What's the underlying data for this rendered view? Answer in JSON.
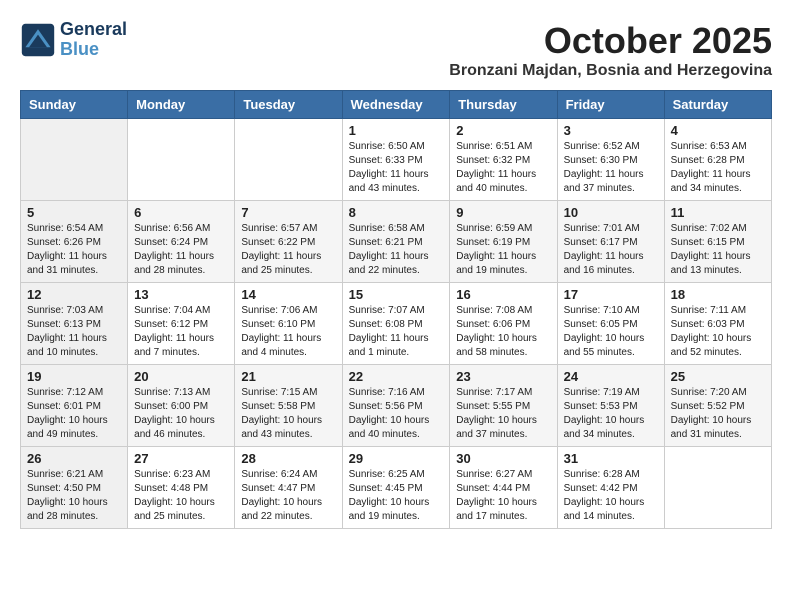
{
  "logo": {
    "line1": "General",
    "line2": "Blue"
  },
  "title": "October 2025",
  "location": "Bronzani Majdan, Bosnia and Herzegovina",
  "weekdays": [
    "Sunday",
    "Monday",
    "Tuesday",
    "Wednesday",
    "Thursday",
    "Friday",
    "Saturday"
  ],
  "weeks": [
    [
      {
        "day": "",
        "info": ""
      },
      {
        "day": "",
        "info": ""
      },
      {
        "day": "",
        "info": ""
      },
      {
        "day": "1",
        "info": "Sunrise: 6:50 AM\nSunset: 6:33 PM\nDaylight: 11 hours and 43 minutes."
      },
      {
        "day": "2",
        "info": "Sunrise: 6:51 AM\nSunset: 6:32 PM\nDaylight: 11 hours and 40 minutes."
      },
      {
        "day": "3",
        "info": "Sunrise: 6:52 AM\nSunset: 6:30 PM\nDaylight: 11 hours and 37 minutes."
      },
      {
        "day": "4",
        "info": "Sunrise: 6:53 AM\nSunset: 6:28 PM\nDaylight: 11 hours and 34 minutes."
      }
    ],
    [
      {
        "day": "5",
        "info": "Sunrise: 6:54 AM\nSunset: 6:26 PM\nDaylight: 11 hours and 31 minutes."
      },
      {
        "day": "6",
        "info": "Sunrise: 6:56 AM\nSunset: 6:24 PM\nDaylight: 11 hours and 28 minutes."
      },
      {
        "day": "7",
        "info": "Sunrise: 6:57 AM\nSunset: 6:22 PM\nDaylight: 11 hours and 25 minutes."
      },
      {
        "day": "8",
        "info": "Sunrise: 6:58 AM\nSunset: 6:21 PM\nDaylight: 11 hours and 22 minutes."
      },
      {
        "day": "9",
        "info": "Sunrise: 6:59 AM\nSunset: 6:19 PM\nDaylight: 11 hours and 19 minutes."
      },
      {
        "day": "10",
        "info": "Sunrise: 7:01 AM\nSunset: 6:17 PM\nDaylight: 11 hours and 16 minutes."
      },
      {
        "day": "11",
        "info": "Sunrise: 7:02 AM\nSunset: 6:15 PM\nDaylight: 11 hours and 13 minutes."
      }
    ],
    [
      {
        "day": "12",
        "info": "Sunrise: 7:03 AM\nSunset: 6:13 PM\nDaylight: 11 hours and 10 minutes."
      },
      {
        "day": "13",
        "info": "Sunrise: 7:04 AM\nSunset: 6:12 PM\nDaylight: 11 hours and 7 minutes."
      },
      {
        "day": "14",
        "info": "Sunrise: 7:06 AM\nSunset: 6:10 PM\nDaylight: 11 hours and 4 minutes."
      },
      {
        "day": "15",
        "info": "Sunrise: 7:07 AM\nSunset: 6:08 PM\nDaylight: 11 hours and 1 minute."
      },
      {
        "day": "16",
        "info": "Sunrise: 7:08 AM\nSunset: 6:06 PM\nDaylight: 10 hours and 58 minutes."
      },
      {
        "day": "17",
        "info": "Sunrise: 7:10 AM\nSunset: 6:05 PM\nDaylight: 10 hours and 55 minutes."
      },
      {
        "day": "18",
        "info": "Sunrise: 7:11 AM\nSunset: 6:03 PM\nDaylight: 10 hours and 52 minutes."
      }
    ],
    [
      {
        "day": "19",
        "info": "Sunrise: 7:12 AM\nSunset: 6:01 PM\nDaylight: 10 hours and 49 minutes."
      },
      {
        "day": "20",
        "info": "Sunrise: 7:13 AM\nSunset: 6:00 PM\nDaylight: 10 hours and 46 minutes."
      },
      {
        "day": "21",
        "info": "Sunrise: 7:15 AM\nSunset: 5:58 PM\nDaylight: 10 hours and 43 minutes."
      },
      {
        "day": "22",
        "info": "Sunrise: 7:16 AM\nSunset: 5:56 PM\nDaylight: 10 hours and 40 minutes."
      },
      {
        "day": "23",
        "info": "Sunrise: 7:17 AM\nSunset: 5:55 PM\nDaylight: 10 hours and 37 minutes."
      },
      {
        "day": "24",
        "info": "Sunrise: 7:19 AM\nSunset: 5:53 PM\nDaylight: 10 hours and 34 minutes."
      },
      {
        "day": "25",
        "info": "Sunrise: 7:20 AM\nSunset: 5:52 PM\nDaylight: 10 hours and 31 minutes."
      }
    ],
    [
      {
        "day": "26",
        "info": "Sunrise: 6:21 AM\nSunset: 4:50 PM\nDaylight: 10 hours and 28 minutes."
      },
      {
        "day": "27",
        "info": "Sunrise: 6:23 AM\nSunset: 4:48 PM\nDaylight: 10 hours and 25 minutes."
      },
      {
        "day": "28",
        "info": "Sunrise: 6:24 AM\nSunset: 4:47 PM\nDaylight: 10 hours and 22 minutes."
      },
      {
        "day": "29",
        "info": "Sunrise: 6:25 AM\nSunset: 4:45 PM\nDaylight: 10 hours and 19 minutes."
      },
      {
        "day": "30",
        "info": "Sunrise: 6:27 AM\nSunset: 4:44 PM\nDaylight: 10 hours and 17 minutes."
      },
      {
        "day": "31",
        "info": "Sunrise: 6:28 AM\nSunset: 4:42 PM\nDaylight: 10 hours and 14 minutes."
      },
      {
        "day": "",
        "info": ""
      }
    ]
  ]
}
